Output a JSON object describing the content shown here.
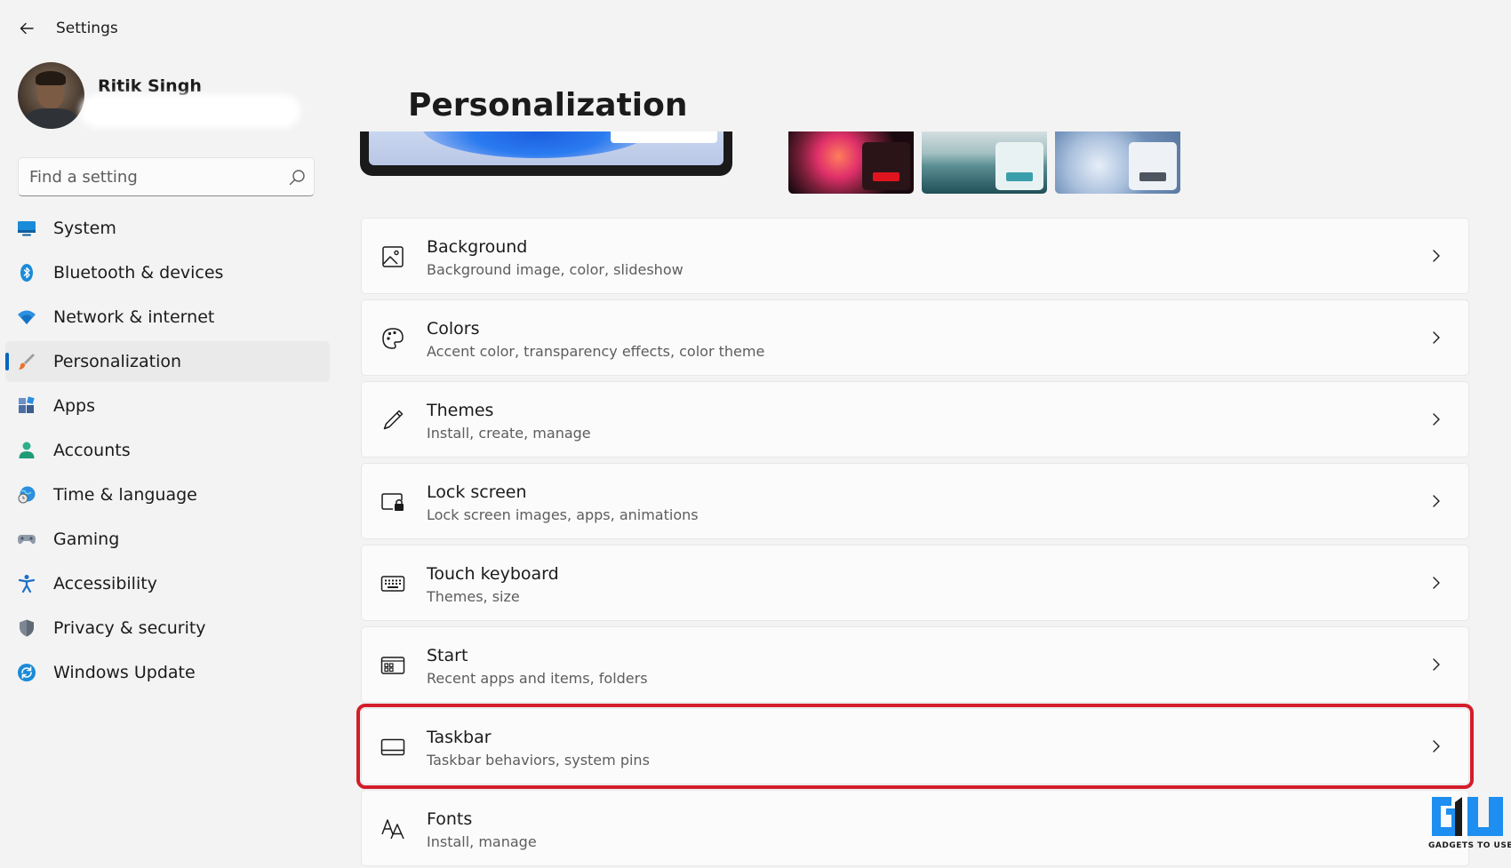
{
  "app": {
    "title": "Settings"
  },
  "profile": {
    "name": "Ritik Singh"
  },
  "search": {
    "placeholder": "Find a setting",
    "value": ""
  },
  "sidebar": {
    "items": [
      {
        "label": "System",
        "icon": "monitor-icon",
        "active": false
      },
      {
        "label": "Bluetooth & devices",
        "icon": "bluetooth-icon",
        "active": false
      },
      {
        "label": "Network & internet",
        "icon": "wifi-icon",
        "active": false
      },
      {
        "label": "Personalization",
        "icon": "brush-icon",
        "active": true
      },
      {
        "label": "Apps",
        "icon": "apps-icon",
        "active": false
      },
      {
        "label": "Accounts",
        "icon": "person-icon",
        "active": false
      },
      {
        "label": "Time & language",
        "icon": "globe-clock-icon",
        "active": false
      },
      {
        "label": "Gaming",
        "icon": "gamepad-icon",
        "active": false
      },
      {
        "label": "Accessibility",
        "icon": "accessibility-icon",
        "active": false
      },
      {
        "label": "Privacy & security",
        "icon": "shield-icon",
        "active": false
      },
      {
        "label": "Windows Update",
        "icon": "update-icon",
        "active": false
      }
    ]
  },
  "main": {
    "title": "Personalization",
    "cards": [
      {
        "title": "Background",
        "subtitle": "Background image, color, slideshow",
        "icon": "image-icon"
      },
      {
        "title": "Colors",
        "subtitle": "Accent color, transparency effects, color theme",
        "icon": "palette-icon"
      },
      {
        "title": "Themes",
        "subtitle": "Install, create, manage",
        "icon": "pen-icon"
      },
      {
        "title": "Lock screen",
        "subtitle": "Lock screen images, apps, animations",
        "icon": "lock-screen-icon"
      },
      {
        "title": "Touch keyboard",
        "subtitle": "Themes, size",
        "icon": "keyboard-icon"
      },
      {
        "title": "Start",
        "subtitle": "Recent apps and items, folders",
        "icon": "start-icon"
      },
      {
        "title": "Taskbar",
        "subtitle": "Taskbar behaviors, system pins",
        "icon": "taskbar-icon",
        "highlighted": true
      },
      {
        "title": "Fonts",
        "subtitle": "Install, manage",
        "icon": "fonts-icon"
      }
    ]
  },
  "colors": {
    "accent": "#0067c0",
    "highlight": "#d41d2a",
    "background": "#f3f3f3",
    "card": "#fbfbfb"
  },
  "watermark": {
    "text": "GADGETS TO USE"
  }
}
